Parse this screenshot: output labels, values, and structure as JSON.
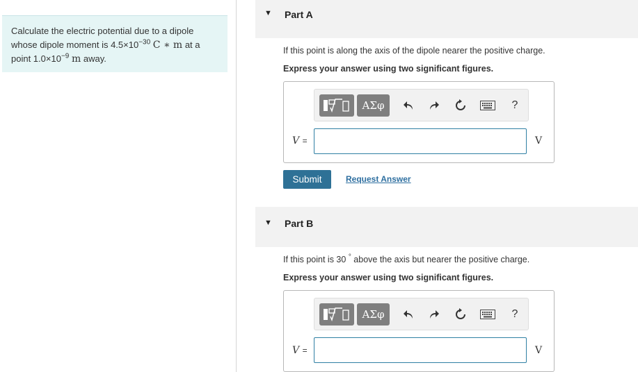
{
  "problem": {
    "line1": "Calculate the electric potential due to a dipole",
    "line2_pre": "whose dipole moment is 4.5×10",
    "moment_exp": "−30",
    "moment_unit": "C ∗ m",
    "line2_post": " at a",
    "line3_pre": "point 1.0×10",
    "distance_exp": "−9",
    "distance_unit": "m",
    "line3_post": " away."
  },
  "partA": {
    "title": "Part A",
    "prompt": "If this point is along the axis of the dipole nearer the positive charge.",
    "instruction": "Express your answer using two significant figures.",
    "variable": "V",
    "equals": "=",
    "unit": "V",
    "input_value": ""
  },
  "partB": {
    "title": "Part B",
    "prompt_pre": "If this point is 30",
    "degree": "°",
    "prompt_post": " above the axis but nearer the positive charge.",
    "instruction": "Express your answer using two significant figures.",
    "variable": "V",
    "equals": "=",
    "unit": "V",
    "input_value": ""
  },
  "toolbar": {
    "greek_label": "ΑΣφ",
    "help_label": "?",
    "icons": [
      "templates-icon",
      "greek-symbols-icon",
      "undo-icon",
      "redo-icon",
      "reset-icon",
      "keyboard-icon",
      "help-icon"
    ]
  },
  "actions": {
    "submit_label": "Submit",
    "request_label": "Request Answer"
  },
  "colors": {
    "problem_bg": "#e5f5f5",
    "header_bg": "#f2f2f2",
    "submit_bg": "#2e7196",
    "link": "#2e6fa0",
    "input_border": "#2e7fa3"
  }
}
